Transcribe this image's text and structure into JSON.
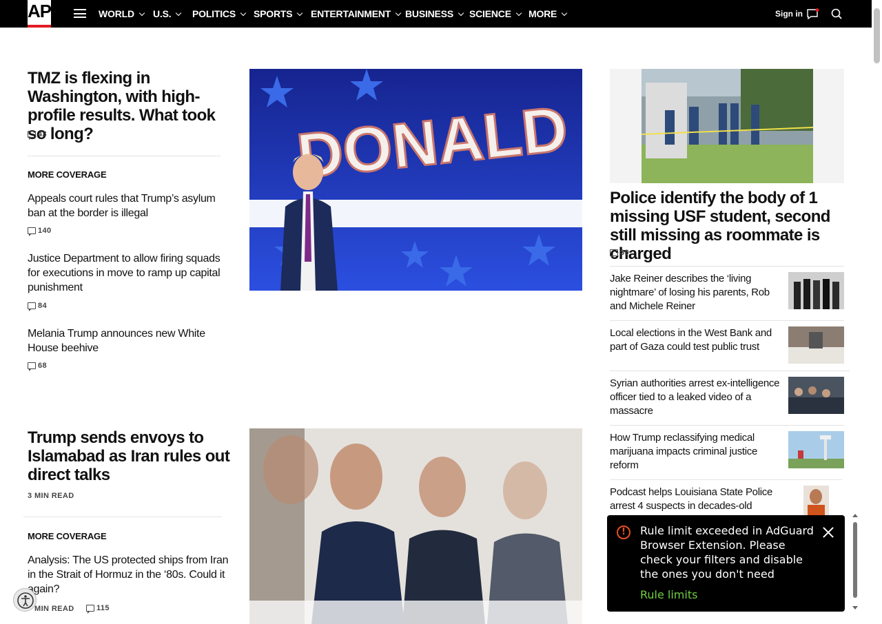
{
  "brand": {
    "logo_text": "AP"
  },
  "nav": {
    "items": [
      "WORLD",
      "U.S.",
      "POLITICS",
      "SPORTS",
      "ENTERTAINMENT",
      "BUSINESS",
      "SCIENCE",
      "MORE"
    ],
    "signin": "Sign in"
  },
  "lead1": {
    "headline": "TMZ is flexing in Washington, with high-profile results. What took so long?",
    "comments": "43",
    "image_text": "DONALD",
    "more_label": "MORE COVERAGE",
    "related": [
      {
        "title": "Appeals court rules that Trump’s asylum ban at the border is illegal",
        "comments": "140"
      },
      {
        "title": "Justice Department to allow firing squads for executions in move to ramp up capital punishment",
        "comments": "84"
      },
      {
        "title": "Melania Trump announces new White House beehive",
        "comments": "68"
      }
    ]
  },
  "lead2": {
    "headline": "Trump sends envoys to Islamabad as Iran rules out direct talks",
    "read_time": "3 MIN READ",
    "more_label": "MORE COVERAGE",
    "related": [
      {
        "title": "Analysis: The US protected ships from Iran in the Strait of Hormuz in the ‘80s. Could it again?",
        "read_time": "MIN READ",
        "comments": "115"
      }
    ]
  },
  "sidebar": {
    "top": {
      "headline": "Police identify the body of 1 missing USF student, second still missing as roommate is charged",
      "comments": "39"
    },
    "items": [
      {
        "title": "Jake Reiner describes the ‘living nightmare’ of losing his parents, Rob and Michele Reiner"
      },
      {
        "title": "Local elections in the West Bank and part of Gaza could test public trust"
      },
      {
        "title": "Syrian authorities arrest ex-intelligence officer tied to a leaked video of a massacre"
      },
      {
        "title": "How Trump reclassifying medical marijuana impacts criminal justice reform"
      },
      {
        "title": "Podcast helps Louisiana State Police arrest 4 suspects in decades-old"
      }
    ]
  },
  "toast": {
    "message": "Rule limit exceeded in AdGuard Browser Extension. Please check your filters and disable the ones you don't need",
    "link": "Rule limits"
  },
  "colors": {
    "nav_bg": "#000000",
    "accent_red": "#e31b23",
    "toast_link": "#6fcf3f",
    "warning": "#e8501e"
  }
}
